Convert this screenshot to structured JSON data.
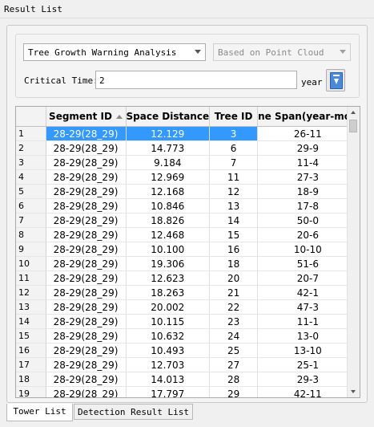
{
  "window": {
    "title": "Result List"
  },
  "controls": {
    "analysis_select": "Tree Growth Warning Analysis",
    "source_select": "Based on Point Cloud",
    "critical_time_label": "Critical Time:",
    "critical_time_value": "2",
    "unit_label": "year",
    "export_icon": "export-document-icon"
  },
  "table": {
    "columns": [
      "Segment ID",
      "Space Distance",
      "Tree ID",
      "ne Span(year-mon"
    ],
    "sorted_column": "Segment ID",
    "rows": [
      {
        "n": "1",
        "seg": "28-29(28_29)",
        "dist": "12.129",
        "tree": "3",
        "span": "26-11"
      },
      {
        "n": "2",
        "seg": "28-29(28_29)",
        "dist": "14.773",
        "tree": "6",
        "span": "29-9"
      },
      {
        "n": "3",
        "seg": "28-29(28_29)",
        "dist": "9.184",
        "tree": "7",
        "span": "11-4"
      },
      {
        "n": "4",
        "seg": "28-29(28_29)",
        "dist": "12.969",
        "tree": "11",
        "span": "27-3"
      },
      {
        "n": "5",
        "seg": "28-29(28_29)",
        "dist": "12.168",
        "tree": "12",
        "span": "18-9"
      },
      {
        "n": "6",
        "seg": "28-29(28_29)",
        "dist": "10.846",
        "tree": "13",
        "span": "17-8"
      },
      {
        "n": "7",
        "seg": "28-29(28_29)",
        "dist": "18.826",
        "tree": "14",
        "span": "50-0"
      },
      {
        "n": "8",
        "seg": "28-29(28_29)",
        "dist": "12.468",
        "tree": "15",
        "span": "20-6"
      },
      {
        "n": "9",
        "seg": "28-29(28_29)",
        "dist": "10.100",
        "tree": "16",
        "span": "10-10"
      },
      {
        "n": "10",
        "seg": "28-29(28_29)",
        "dist": "19.306",
        "tree": "18",
        "span": "51-6"
      },
      {
        "n": "11",
        "seg": "28-29(28_29)",
        "dist": "12.623",
        "tree": "20",
        "span": "20-7"
      },
      {
        "n": "12",
        "seg": "28-29(28_29)",
        "dist": "18.263",
        "tree": "21",
        "span": "42-1"
      },
      {
        "n": "13",
        "seg": "28-29(28_29)",
        "dist": "20.002",
        "tree": "22",
        "span": "47-3"
      },
      {
        "n": "14",
        "seg": "28-29(28_29)",
        "dist": "10.115",
        "tree": "23",
        "span": "11-1"
      },
      {
        "n": "15",
        "seg": "28-29(28_29)",
        "dist": "10.632",
        "tree": "24",
        "span": "13-0"
      },
      {
        "n": "16",
        "seg": "28-29(28_29)",
        "dist": "10.493",
        "tree": "25",
        "span": "13-10"
      },
      {
        "n": "17",
        "seg": "28-29(28_29)",
        "dist": "12.703",
        "tree": "27",
        "span": "25-1"
      },
      {
        "n": "18",
        "seg": "28-29(28_29)",
        "dist": "14.013",
        "tree": "28",
        "span": "29-3"
      },
      {
        "n": "19",
        "seg": "28-29(28_29)",
        "dist": "17.797",
        "tree": "29",
        "span": "42-11"
      }
    ]
  },
  "tabs": [
    "Tower List",
    "Detection Result List"
  ],
  "colors": {
    "selection": "#3399ff"
  }
}
